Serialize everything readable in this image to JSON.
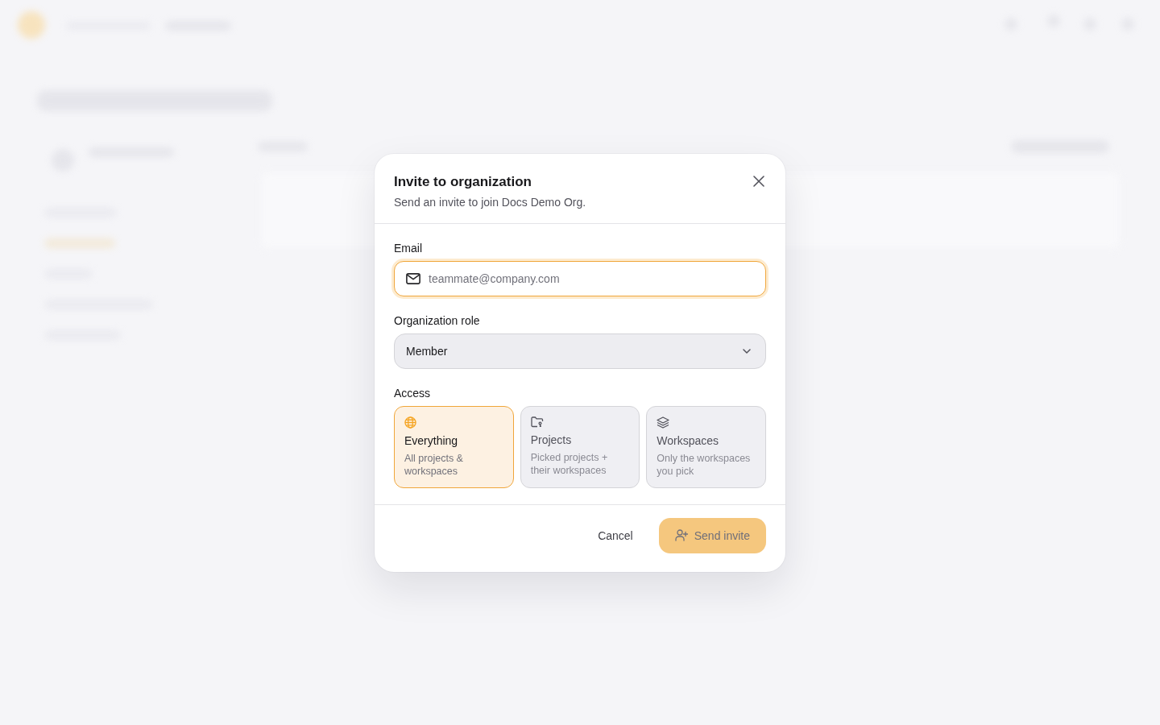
{
  "dialog": {
    "title": "Invite to organization",
    "subtitle": "Send an invite to join Docs Demo Org."
  },
  "email": {
    "label": "Email",
    "placeholder": "teammate@company.com",
    "focused": true
  },
  "role": {
    "label": "Organization role",
    "value": "Member"
  },
  "access": {
    "label": "Access",
    "options": [
      {
        "kind": "globe",
        "title": "Everything",
        "description": "All projects & workspaces",
        "selected": true
      },
      {
        "kind": "folder",
        "title": "Projects",
        "description": "Picked projects + their workspaces",
        "selected": false
      },
      {
        "kind": "layers",
        "title": "Workspaces",
        "description": "Only the workspaces you pick",
        "selected": false
      }
    ]
  },
  "footer": {
    "cancel": "Cancel",
    "submit": {
      "label": "Send invite",
      "disabled": true
    }
  }
}
